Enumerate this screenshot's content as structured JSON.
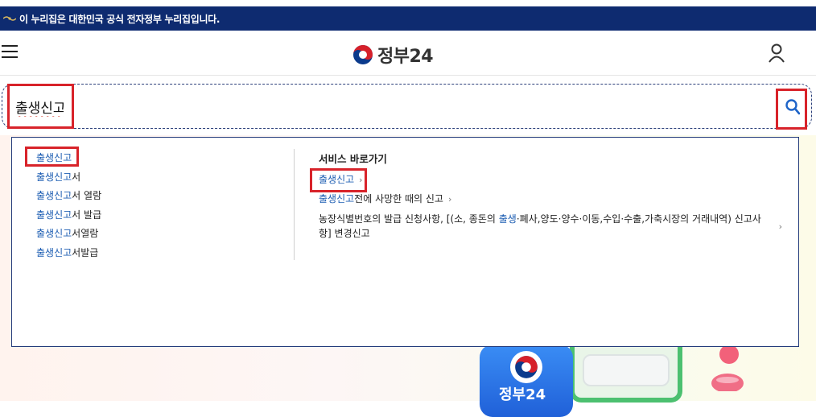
{
  "banner": {
    "text": "이 누리집은 대한민국 공식 전자정부 누리집입니다."
  },
  "header": {
    "logo_text": "정부24",
    "menu_icon": "hamburger-menu-icon",
    "user_icon": "user-icon"
  },
  "search": {
    "value": "출생신고",
    "icon": "search-icon"
  },
  "suggestions": {
    "items": [
      {
        "keyword": "출생신고",
        "rest": ""
      },
      {
        "keyword": "출생신고",
        "rest": "서"
      },
      {
        "keyword": "출생신고",
        "rest": "서 열람"
      },
      {
        "keyword": "출생신고",
        "rest": "서 발급"
      },
      {
        "keyword": "출생신고",
        "rest": "서열람"
      },
      {
        "keyword": "출생신고",
        "rest": "서발급"
      }
    ]
  },
  "services": {
    "title": "서비스 바로가기",
    "chevron": "›",
    "rows": [
      {
        "pre": "",
        "keyword": "출생신고",
        "post": ""
      },
      {
        "pre": "",
        "keyword": "출생신고",
        "post": "전에 사망한 때의 신고"
      },
      {
        "pre": "농장식별번호의 발급 신청사항, [(소, 종돈의 ",
        "keyword": "출생",
        "post": "·폐사,양도·양수·이동,수입·수출,가축시장의 거래내역) 신고사항] 변경신고"
      }
    ]
  },
  "hero": {
    "phone_text": "정부24"
  },
  "colors": {
    "banner_bg": "#0e2b70",
    "highlight_red": "#d8232a",
    "keyword_blue": "#1f5fb3",
    "search_border": "#2b3f7a"
  }
}
